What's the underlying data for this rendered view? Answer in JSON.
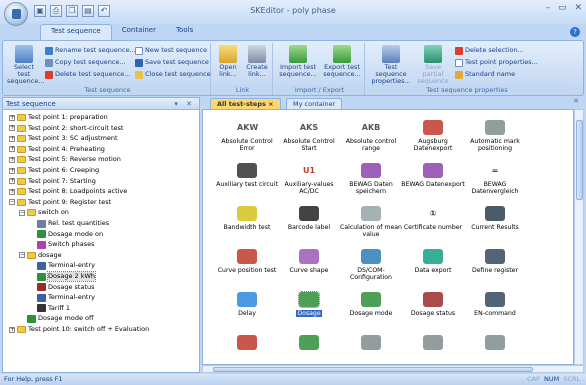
{
  "window": {
    "title": "SKEditor - poly phase"
  },
  "qat": [
    "save-icon",
    "print-icon",
    "copy-icon",
    "paste-icon",
    "undo-icon"
  ],
  "qat_glyphs": [
    "▣",
    "⎙",
    "❐",
    "▤",
    "↶"
  ],
  "window_controls": [
    "–",
    "▭",
    "✕"
  ],
  "ribbon_tabs": [
    "Test sequence",
    "Container",
    "Tools"
  ],
  "ribbon": {
    "test_sequence_group": {
      "label": "Test sequence",
      "select_line1": "Select test",
      "select_line2": "sequence...",
      "rename": "Rename test sequence...",
      "copy": "Copy test sequence...",
      "delete": "Delete test sequence...",
      "new": "New test sequence",
      "save": "Save test sequence",
      "close": "Close test sequence"
    },
    "link_group": {
      "label": "Link",
      "open_line1": "Open",
      "open_line2": "link...",
      "create_line1": "Create",
      "create_line2": "link..."
    },
    "import_export_group": {
      "label": "Import / Export",
      "import_line1": "Import test",
      "import_line2": "sequence...",
      "export_line1": "Export test",
      "export_line2": "sequence..."
    },
    "properties_group": {
      "label": "Test sequence properties",
      "props_line1": "Test sequence",
      "props_line2": "properties...",
      "savepartial_line1": "Save partial",
      "savepartial_line2": "sequence",
      "delete_selection": "Delete selection...",
      "test_point_props": "Test point properties...",
      "standard_name": "Standard name"
    }
  },
  "left_panel": {
    "title": "Test sequence",
    "controls": "▾ ✕",
    "tree": [
      {
        "label": "Test point 1: preparation",
        "level": 0,
        "toggle": "+",
        "type": "folder"
      },
      {
        "label": "Test point 2: short-circuit test",
        "level": 0,
        "toggle": "+",
        "type": "folder"
      },
      {
        "label": "Test point 3: SC adjustment",
        "level": 0,
        "toggle": "+",
        "type": "folder"
      },
      {
        "label": "Test point 4: Preheating",
        "level": 0,
        "toggle": "+",
        "type": "folder"
      },
      {
        "label": "Test point 5: Reverse motion",
        "level": 0,
        "toggle": "+",
        "type": "folder"
      },
      {
        "label": "Test point 6: Creeping",
        "level": 0,
        "toggle": "+",
        "type": "folder"
      },
      {
        "label": "Test point 7: Starting",
        "level": 0,
        "toggle": "+",
        "type": "folder"
      },
      {
        "label": "Test point 8: Loadpoints active",
        "level": 0,
        "toggle": "+",
        "type": "folder"
      },
      {
        "label": "Test point 9: Register test",
        "level": 0,
        "toggle": "−",
        "type": "folder"
      },
      {
        "label": "switch on",
        "level": 1,
        "toggle": "−",
        "type": "folder"
      },
      {
        "label": "Rel. test quantities",
        "level": 2,
        "toggle": "",
        "type": "item",
        "color": "#6b7fa3"
      },
      {
        "label": "Dosage mode on",
        "level": 2,
        "toggle": "",
        "type": "item",
        "color": "#2f8f3a"
      },
      {
        "label": "Switch phases",
        "level": 2,
        "toggle": "",
        "type": "item",
        "color": "#b03fb0"
      },
      {
        "label": "dosage",
        "level": 1,
        "toggle": "−",
        "type": "folder"
      },
      {
        "label": "Terminal-entry",
        "level": 2,
        "toggle": "",
        "type": "item",
        "color": "#3d5fa8"
      },
      {
        "label": "Dosage 2 kWh",
        "level": 2,
        "toggle": "",
        "type": "item",
        "color": "#2f8f3a",
        "selected": true
      },
      {
        "label": "Dosage status",
        "level": 2,
        "toggle": "",
        "type": "item",
        "color": "#9a2c2c"
      },
      {
        "label": "Terminal-entry",
        "level": 2,
        "toggle": "",
        "type": "item",
        "color": "#3d5fa8"
      },
      {
        "label": "Tariff 1",
        "level": 2,
        "toggle": "",
        "type": "item",
        "color": "#333333"
      },
      {
        "label": "Dosage mode off",
        "level": 1,
        "toggle": "",
        "type": "item",
        "color": "#2f8f3a"
      },
      {
        "label": "Test point 10: switch off + Evaluation",
        "level": 0,
        "toggle": "+",
        "type": "folder"
      }
    ]
  },
  "doc_tabs": [
    {
      "label": "All test-steps",
      "active": true
    },
    {
      "label": "My container",
      "active": false
    }
  ],
  "doc_close": "✕",
  "test_steps": [
    {
      "label": "Absolute Control Error",
      "icon_text": "AKW",
      "color": "#555555"
    },
    {
      "label": "Absolute Control Start",
      "icon_text": "AKS",
      "color": "#555555"
    },
    {
      "label": "Absolute control range",
      "icon_text": "AKB",
      "color": "#555555"
    },
    {
      "label": "Augsburg Datenexport",
      "icon_text": "",
      "color": "#c0392b"
    },
    {
      "label": "Automatic mark positioning",
      "icon_text": "",
      "color": "#7f8c8d"
    },
    {
      "label": "Auxiliary test circuit",
      "icon_text": "",
      "color": "#333333"
    },
    {
      "label": "Auxiliary-values AC/DC",
      "icon_text": "U1",
      "color": "#c0392b"
    },
    {
      "label": "BEWAG Daten speichern",
      "icon_text": "",
      "color": "#8e44ad"
    },
    {
      "label": "BEWAG Datenexport",
      "icon_text": "",
      "color": "#8e44ad"
    },
    {
      "label": "BEWAG Datenvergleich",
      "icon_text": "=",
      "color": "#333333"
    },
    {
      "label": "Bandwidth test",
      "icon_text": "",
      "color": "#d4c21a"
    },
    {
      "label": "Barcode label",
      "icon_text": "",
      "color": "#222222"
    },
    {
      "label": "Calculation of mean value",
      "icon_text": "",
      "color": "#95a5a6"
    },
    {
      "label": "Certificate number",
      "icon_text": "①",
      "color": "#222222"
    },
    {
      "label": "Current Results",
      "icon_text": "",
      "color": "#2c3e50"
    },
    {
      "label": "Curve position test",
      "icon_text": "",
      "color": "#c0392b"
    },
    {
      "label": "Curve shape",
      "icon_text": "",
      "color": "#9b59b6"
    },
    {
      "label": "DS/COM-Configuration",
      "icon_text": "",
      "color": "#2980b9"
    },
    {
      "label": "Data export",
      "icon_text": "",
      "color": "#16a085"
    },
    {
      "label": "Define register",
      "icon_text": "",
      "color": "#34495e"
    },
    {
      "label": "Delay",
      "icon_text": "",
      "color": "#2e86de"
    },
    {
      "label": "Dosage",
      "icon_text": "",
      "color": "#2f8f3a",
      "selected": true
    },
    {
      "label": "Dosage mode",
      "icon_text": "",
      "color": "#2f8f3a"
    },
    {
      "label": "Dosage status",
      "icon_text": "",
      "color": "#9a2c2c"
    },
    {
      "label": "EN-command",
      "icon_text": "",
      "color": "#34495e"
    },
    {
      "label": "",
      "icon_text": "",
      "color": "#c0392b"
    },
    {
      "label": "",
      "icon_text": "",
      "color": "#2f8f3a"
    },
    {
      "label": "",
      "icon_text": "",
      "color": "#7f8c8d"
    },
    {
      "label": "",
      "icon_text": "",
      "color": "#7f8c8d"
    },
    {
      "label": "",
      "icon_text": "",
      "color": "#7f8c8d"
    }
  ],
  "statusbar": {
    "text": "For Help, press F1",
    "indicators": [
      {
        "label": "CAP",
        "active": false
      },
      {
        "label": "NUM",
        "active": true
      },
      {
        "label": "SCRL",
        "active": false
      }
    ]
  }
}
